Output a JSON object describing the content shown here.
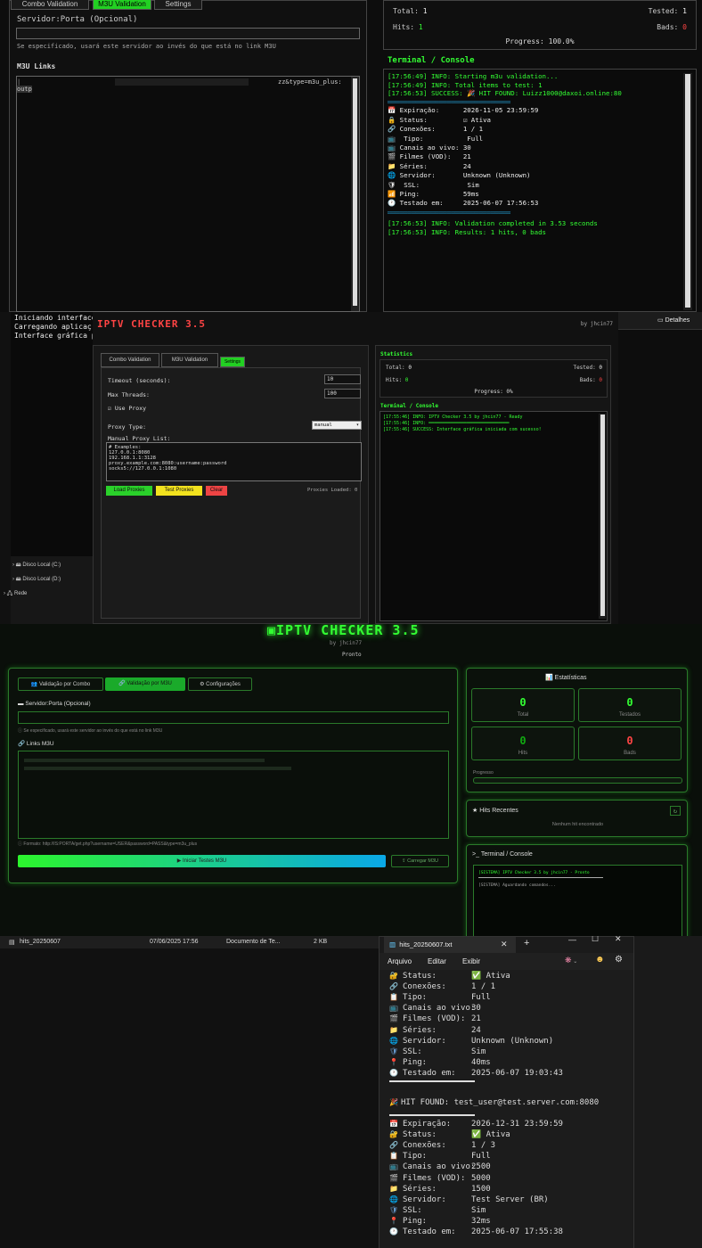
{
  "p1": {
    "tabs": [
      "Combo Validation",
      "M3U Validation",
      "Settings"
    ],
    "server_label": "Servidor:Porta (Opcional)",
    "server_hint": "Se especificado, usará este servidor ao invés do que está no link M3U",
    "m3u_label": "M3U Links",
    "m3u_text": "zz&type=m3u_plus:",
    "m3u_line2": "outp",
    "stats": {
      "total_label": "Total:",
      "total": "1",
      "tested_label": "Tested:",
      "tested": "1",
      "hits_label": "Hits:",
      "hits": "1",
      "bads_label": "Bads:",
      "bads": "0",
      "progress": "Progress: 100.0%"
    },
    "console_title": "Terminal / Console",
    "console": [
      {
        "t": "[17:56:49] INFO: Starting m3u validation...",
        "c": "g"
      },
      {
        "t": "[17:56:49] INFO: Total items to test: 1",
        "c": "g"
      },
      {
        "t": "[17:56:53] SUCCESS: 🎉 HIT FOUND: Luizz1000@daxoi.online:80",
        "c": "g"
      },
      {
        "t": "═══════════════════════════════",
        "c": "c"
      },
      {
        "t": "📅 Expiração:      2026-11-05 23:59:59",
        "c": "w"
      },
      {
        "t": "🔒 Status:         ☑ Ativa",
        "c": "w"
      },
      {
        "t": "🔗 Conexões:       1 / 1",
        "c": "w"
      },
      {
        "t": "📺  Tipo:           Full",
        "c": "w"
      },
      {
        "t": "📺 Canais ao vivo: 30",
        "c": "w"
      },
      {
        "t": "🎬 Filmes (VOD):   21",
        "c": "w"
      },
      {
        "t": "📁 Séries:         24",
        "c": "w"
      },
      {
        "t": "🌐 Servidor:       Unknown (Unknown)",
        "c": "w"
      },
      {
        "t": "🛡  SSL:            Sim",
        "c": "w"
      },
      {
        "t": "📶 Ping:           59ms",
        "c": "w"
      },
      {
        "t": "🕐 Testado em:     2025-06-07 17:56:53",
        "c": "w"
      },
      {
        "t": "═══════════════════════════════",
        "c": "c"
      },
      {
        "t": "[17:56:53] INFO: Validation completed in 3.53 seconds",
        "c": "g"
      },
      {
        "t": "[17:56:53] INFO: Results: 1 hits, 0 bads",
        "c": "g"
      }
    ]
  },
  "p2": {
    "left_log": [
      "Iniciando interface",
      "Carregando aplicaç",
      "Interface gráfica p"
    ],
    "explorer": [
      "Disco Local (C:)",
      "Disco Local (D:)",
      "Rede"
    ],
    "details": "Detalhes",
    "title": "IPTV CHECKER 3.5",
    "by": "by jhcin77",
    "tabs": [
      "Combo Validation",
      "M3U Validation",
      "Settings"
    ],
    "timeout_label": "Timeout (seconds):",
    "timeout": "10",
    "threads_label": "Max Threads:",
    "threads": "100",
    "use_proxy": "Use Proxy",
    "proxy_type_label": "Proxy Type:",
    "proxy_type": "manual",
    "proxy_list_label": "Manual Proxy List:",
    "proxy_list": [
      "# Examples:",
      "127.0.0.1:8080",
      "192.168.1.1:3128",
      "proxy.example.com:8080:username:password",
      "socks5://127.0.0.1:1080"
    ],
    "btn_load": "Load Proxies",
    "btn_test": "Test Proxies",
    "btn_clear": "Clear",
    "loaded": "Proxies Loaded: 0",
    "stats_title": "Statistics",
    "stats": {
      "total_label": "Total:",
      "total": "0",
      "tested_label": "Tested:",
      "tested": "0",
      "hits_label": "Hits:",
      "hits": "0",
      "bads_label": "Bads:",
      "bads": "0",
      "progress": "Progress: 0%"
    },
    "console_title": "Terminal / Console",
    "console": [
      "[17:55:46] INFO: IPTV Checker 3.5 by jhcin77 - Ready",
      "[17:55:46] INFO: ══════════════════════════════",
      "[17:55:46] SUCCESS: Interface gráfica iniciada com sucesso!"
    ]
  },
  "p3": {
    "title": "IPTV CHECKER 3.5",
    "by": "by jhcin77",
    "pronto": "Pronto",
    "tabs": [
      "Validação por Combo",
      "Validação por M3U",
      "Configurações"
    ],
    "server_label": "Servidor:Porta (Opcional)",
    "server_hint": "Se especificado, usará este servidor ao invés do que está no link M3U",
    "m3u_label": "Links M3U",
    "format_hint": "Formato: http://IS:PORTA/get.php?username=USER&password=PASS&type=m3u_plus",
    "btn_start": "▶ Iniciar Testes M3U",
    "btn_load": "Carregar M3U",
    "stats_title": "Estatísticas",
    "cards": [
      {
        "v": "0",
        "l": "Total"
      },
      {
        "v": "0",
        "l": "Testados"
      },
      {
        "v": "0",
        "l": "Hits"
      },
      {
        "v": "0",
        "l": "Bads"
      }
    ],
    "progress_label": "Progresso",
    "hits_title": "Hits Recentes",
    "hits_empty": "Nenhum hit encontrado",
    "console_title": "Terminal / Console",
    "console": [
      "[SISTEMA] IPTV Checker 3.5 by jhcin77 - Pronto",
      "[SISTEMA] Aguardando comandos..."
    ]
  },
  "p4": {
    "file": {
      "name": "hits_20250607",
      "date": "07/06/2025 17:56",
      "type": "Documento de Te...",
      "size": "2 KB"
    },
    "tab": "hits_20250607.txt",
    "menu": [
      "Arquivo",
      "Editar",
      "Exibir"
    ],
    "block1": [
      [
        "🔐",
        "Status:",
        "✅ Ativa"
      ],
      [
        "🔗",
        "Conexões:",
        "1 / 1"
      ],
      [
        "📋",
        "Tipo:",
        "Full"
      ],
      [
        "📺",
        "Canais ao vivo:",
        "30"
      ],
      [
        "🎬",
        "Filmes (VOD):",
        "21"
      ],
      [
        "📁",
        "Séries:",
        "24"
      ],
      [
        "🌐",
        "Servidor:",
        "Unknown (Unknown)"
      ],
      [
        "🛡",
        "SSL:",
        "Sim"
      ],
      [
        "📍",
        "Ping:",
        "40ms"
      ],
      [
        "🕐",
        "Testado em:",
        "2025-06-07 19:03:43"
      ]
    ],
    "hit2": "HIT FOUND: test_user@test.server.com:8080",
    "block2": [
      [
        "📅",
        "Expiração:",
        "2026-12-31 23:59:59"
      ],
      [
        "🔐",
        "Status:",
        "✅ Ativa"
      ],
      [
        "🔗",
        "Conexões:",
        "1 / 3"
      ],
      [
        "📋",
        "Tipo:",
        "Full"
      ],
      [
        "📺",
        "Canais ao vivo:",
        "2500"
      ],
      [
        "🎬",
        "Filmes (VOD):",
        "5000"
      ],
      [
        "📁",
        "Séries:",
        "1500"
      ],
      [
        "🌐",
        "Servidor:",
        "Test Server (BR)"
      ],
      [
        "🛡",
        "SSL:",
        "Sim"
      ],
      [
        "📍",
        "Ping:",
        "32ms"
      ],
      [
        "🕐",
        "Testado em:",
        "2025-06-07 17:55:38"
      ]
    ]
  }
}
